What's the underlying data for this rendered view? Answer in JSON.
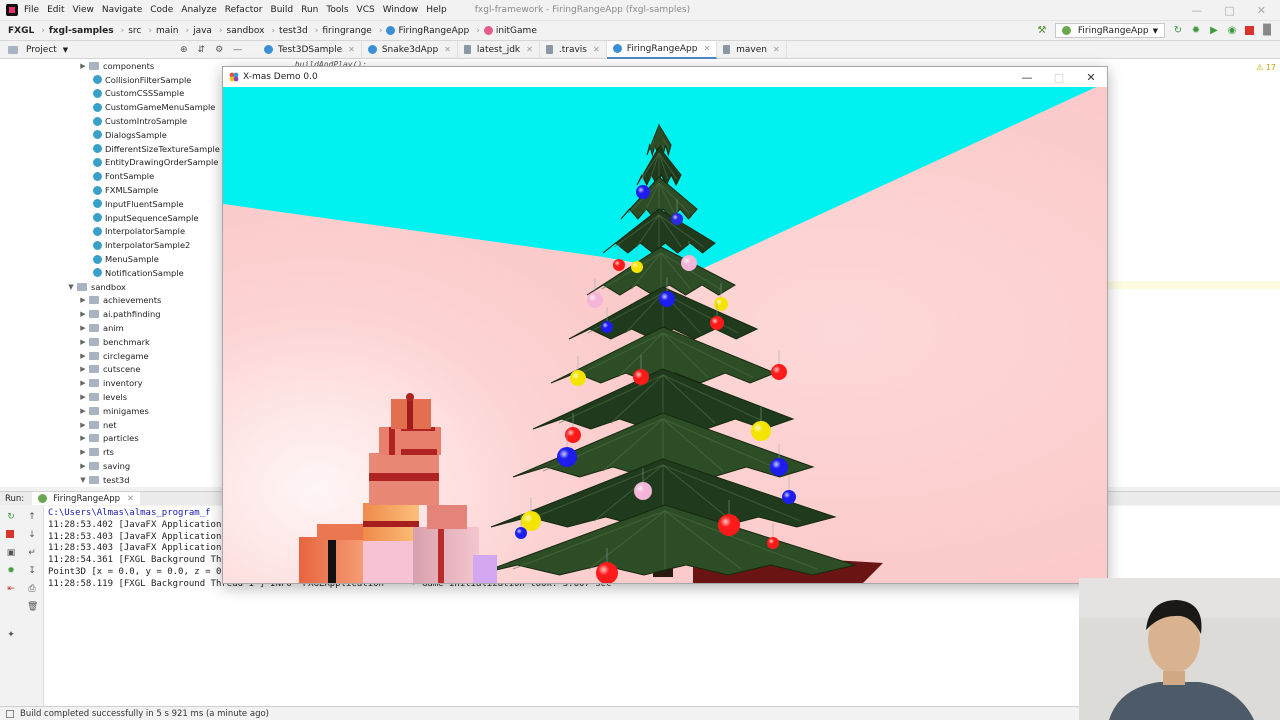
{
  "menu": {
    "items": [
      "File",
      "Edit",
      "View",
      "Navigate",
      "Code",
      "Analyze",
      "Refactor",
      "Build",
      "Run",
      "Tools",
      "VCS",
      "Window",
      "Help"
    ],
    "window_title": "fxgl-framework - FiringRangeApp (fxgl-samples)"
  },
  "nav": {
    "crumbs": [
      "FXGL",
      "fxgl-samples",
      "src",
      "main",
      "java",
      "sandbox",
      "test3d",
      "firingrange",
      "FiringRangeApp",
      "initGame"
    ],
    "run_config": "FiringRangeApp"
  },
  "project": {
    "label": "Project"
  },
  "tabs": [
    "Test3DSample",
    "Snake3dApp",
    "latest_jdk",
    ".travis",
    "FiringRangeApp",
    "maven"
  ],
  "editor": {
    "code_snippet": ".buildAndPlay();",
    "warning_count": "17"
  },
  "tree": {
    "items": [
      {
        "label": "components",
        "type": "folder",
        "indent": 1,
        "expandable": true,
        "expanded": false
      },
      {
        "label": "CollisionFilterSample",
        "type": "class",
        "indent": 2
      },
      {
        "label": "CustomCSSSample",
        "type": "class",
        "indent": 2
      },
      {
        "label": "CustomGameMenuSample",
        "type": "class",
        "indent": 2
      },
      {
        "label": "CustomIntroSample",
        "type": "class",
        "indent": 2
      },
      {
        "label": "DialogsSample",
        "type": "class",
        "indent": 2
      },
      {
        "label": "DifferentSizeTextureSample",
        "type": "class",
        "indent": 2
      },
      {
        "label": "EntityDrawingOrderSample",
        "type": "class",
        "indent": 2
      },
      {
        "label": "FontSample",
        "type": "class",
        "indent": 2
      },
      {
        "label": "FXMLSample",
        "type": "class",
        "indent": 2
      },
      {
        "label": "InputFluentSample",
        "type": "class",
        "indent": 2
      },
      {
        "label": "InputSequenceSample",
        "type": "class",
        "indent": 2
      },
      {
        "label": "InterpolatorSample",
        "type": "class",
        "indent": 2
      },
      {
        "label": "InterpolatorSample2",
        "type": "class",
        "indent": 2
      },
      {
        "label": "MenuSample",
        "type": "class",
        "indent": 2
      },
      {
        "label": "NotificationSample",
        "type": "class",
        "indent": 2
      },
      {
        "label": "sandbox",
        "type": "folder",
        "indent": 0,
        "expandable": true,
        "expanded": true
      },
      {
        "label": "achievements",
        "type": "folder",
        "indent": 1,
        "expandable": true,
        "expanded": false
      },
      {
        "label": "ai.pathfinding",
        "type": "folder",
        "indent": 1,
        "expandable": true,
        "expanded": false
      },
      {
        "label": "anim",
        "type": "folder",
        "indent": 1,
        "expandable": true,
        "expanded": false
      },
      {
        "label": "benchmark",
        "type": "folder",
        "indent": 1,
        "expandable": true,
        "expanded": false
      },
      {
        "label": "circlegame",
        "type": "folder",
        "indent": 1,
        "expandable": true,
        "expanded": false
      },
      {
        "label": "cutscene",
        "type": "folder",
        "indent": 1,
        "expandable": true,
        "expanded": false
      },
      {
        "label": "inventory",
        "type": "folder",
        "indent": 1,
        "expandable": true,
        "expanded": false
      },
      {
        "label": "levels",
        "type": "folder",
        "indent": 1,
        "expandable": true,
        "expanded": false
      },
      {
        "label": "minigames",
        "type": "folder",
        "indent": 1,
        "expandable": true,
        "expanded": false
      },
      {
        "label": "net",
        "type": "folder",
        "indent": 1,
        "expandable": true,
        "expanded": false
      },
      {
        "label": "particles",
        "type": "folder",
        "indent": 1,
        "expandable": true,
        "expanded": false
      },
      {
        "label": "rts",
        "type": "folder",
        "indent": 1,
        "expandable": true,
        "expanded": false
      },
      {
        "label": "saving",
        "type": "folder",
        "indent": 1,
        "expandable": true,
        "expanded": false
      },
      {
        "label": "test3d",
        "type": "folder",
        "indent": 1,
        "expandable": true,
        "expanded": true
      }
    ]
  },
  "run": {
    "label": "Run:",
    "tab": "FiringRangeApp",
    "console_lines": [
      "C:\\Users\\Almas\\almas_program_f",
      "11:28:53.402 [JavaFX Application",
      "11:28:53.403 [JavaFX Application",
      "11:28:53.403 [JavaFX Application",
      "11:28:54.361 [FXGL Background Th",
      "Point3D [x = 0.0, y = 0.0, z = 0",
      "11:28:58.119 [FXGL Background Thread 1 ] INFO  FXGLApplication     - Game initialization took: 3.607 sec"
    ]
  },
  "status": {
    "text": "Build completed successfully in 5 s 921 ms (a minute ago)"
  },
  "demo_window": {
    "title": "X-mas Demo 0.0",
    "colors": {
      "sky": "#00f2f0",
      "wall": "#fdd3d3",
      "tree": "#1f3a1c",
      "floor": "#6b1414"
    }
  }
}
